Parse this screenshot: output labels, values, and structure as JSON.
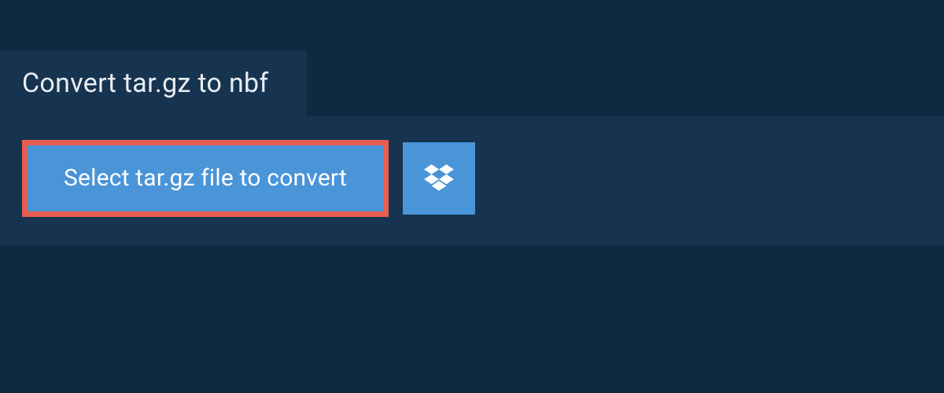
{
  "header": {
    "title": "Convert tar.gz to nbf"
  },
  "actions": {
    "select_file_label": "Select tar.gz file to convert",
    "dropbox_icon_name": "dropbox"
  }
}
